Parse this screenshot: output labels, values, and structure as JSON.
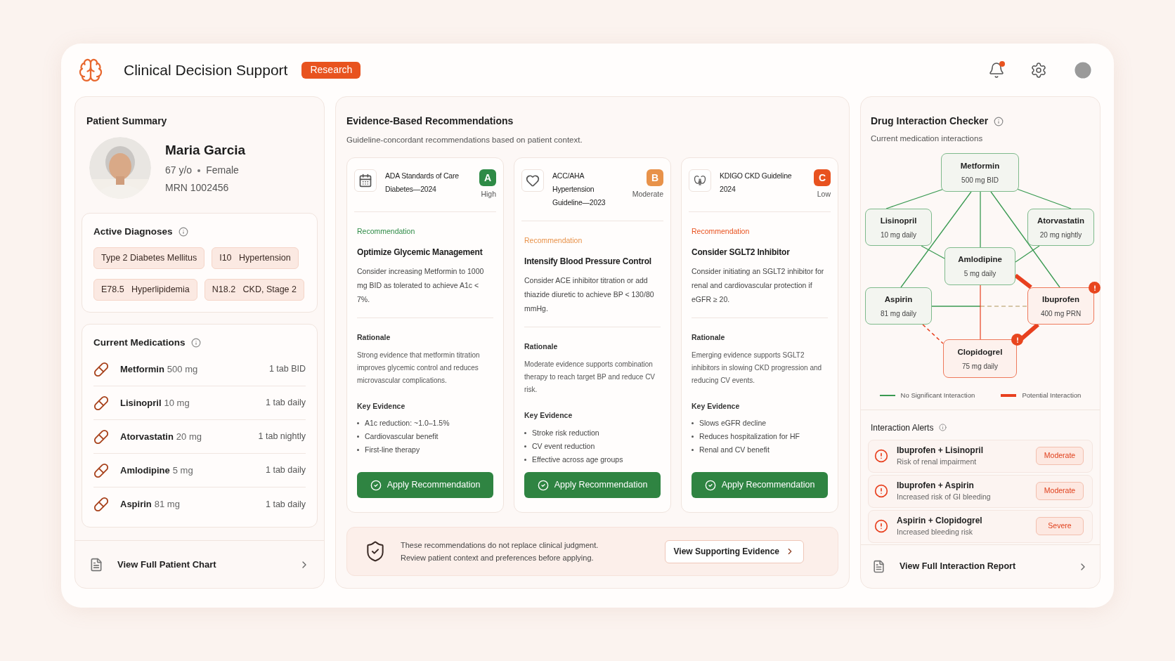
{
  "header": {
    "title": "Clinical Decision Support",
    "badge": "Research",
    "notifications": true
  },
  "patient": {
    "title": "Patient Summary",
    "name": "Maria Garcia",
    "age": "67 y/o",
    "sex": "Female",
    "mrn": "MRN 1002456",
    "diagnoses_title": "Active Diagnoses",
    "diagnoses": [
      {
        "name": "Type 2 Diabetes Mellitus"
      },
      {
        "code": "I10",
        "name": "Hypertension"
      },
      {
        "code": "E78.5",
        "name": "Hyperlipidemia"
      },
      {
        "code": "N18.2",
        "name": "CKD, Stage 2"
      }
    ],
    "medications_title": "Current Medications",
    "medications": [
      {
        "name": "Metformin",
        "dose": "500 mg",
        "sig": "1 tab BID"
      },
      {
        "name": "Lisinopril",
        "dose": "10 mg",
        "sig": "1 tab daily"
      },
      {
        "name": "Atorvastatin",
        "dose": "20 mg",
        "sig": "1 tab nightly"
      },
      {
        "name": "Amlodipine",
        "dose": "5 mg",
        "sig": "1 tab daily"
      },
      {
        "name": "Aspirin",
        "dose": "81 mg",
        "sig": "1 tab daily"
      }
    ],
    "footer_link": "View Full Patient Chart"
  },
  "recommendations": {
    "title": "Evidence-Based Recommendations",
    "subtitle": "Guideline-concordant recommendations based on patient context.",
    "cards": [
      {
        "source": "ADA Standards of Care Diabetes—2024",
        "grade": "A",
        "strength": "High",
        "color": "#2e8b46",
        "label": "Recommendation",
        "title": "Optimize Glycemic Management",
        "text": "Consider increasing Metformin to 1000 mg BID as tolerated to achieve A1c < 7%.",
        "rationale_title": "Rationale",
        "rationale": "Strong evidence that metformin titration improves glycemic control and reduces microvascular complications.",
        "evidence_title": "Key Evidence",
        "evidence": [
          "A1c reduction: ~1.0–1.5%",
          "Cardiovascular benefit",
          "First-line therapy"
        ],
        "button": "Apply Recommendation"
      },
      {
        "source": "ACC/AHA Hypertension Guideline—2023",
        "grade": "B",
        "strength": "Moderate",
        "color": "#e8924a",
        "label": "Recommendation",
        "title": "Intensify Blood Pressure Control",
        "text": "Consider ACE inhibitor titration or add thiazide diuretic to achieve BP < 130/80 mmHg.",
        "rationale_title": "Rationale",
        "rationale": "Moderate evidence supports combination therapy to reach target BP and reduce CV risk.",
        "evidence_title": "Key Evidence",
        "evidence": [
          "Stroke risk reduction",
          "CV event reduction",
          "Effective across age groups"
        ],
        "button": "Apply Recommendation"
      },
      {
        "source": "KDIGO CKD Guideline 2024",
        "grade": "C",
        "strength": "Low",
        "color": "#e8521f",
        "label": "Recommendation",
        "title": "Consider SGLT2 Inhibitor",
        "text": "Consider initiating an SGLT2 inhibitor for renal and cardiovascular protection if eGFR ≥ 20.",
        "rationale_title": "Rationale",
        "rationale": "Emerging evidence supports SGLT2 inhibitors in slowing CKD progression and reducing CV events.",
        "evidence_title": "Key Evidence",
        "evidence": [
          "Slows eGFR decline",
          "Reduces hospitalization for HF",
          "Renal and CV benefit"
        ],
        "button": "Apply Recommendation"
      }
    ],
    "disclaimer": [
      "These recommendations do not replace clinical judgment.",
      "Review patient context and preferences before applying."
    ],
    "evidence_button": "View Supporting Evidence"
  },
  "interactions": {
    "title": "Drug Interaction Checker",
    "subtitle": "Current medication interactions",
    "nodes": [
      {
        "name": "Metformin",
        "dose": "500 mg BID",
        "alert": false
      },
      {
        "name": "Lisinopril",
        "dose": "10 mg daily",
        "alert": false
      },
      {
        "name": "Atorvastatin",
        "dose": "20 mg nightly",
        "alert": false
      },
      {
        "name": "Amlodipine",
        "dose": "5 mg daily",
        "alert": false
      },
      {
        "name": "Aspirin",
        "dose": "81 mg daily",
        "alert": false
      },
      {
        "name": "Ibuprofen",
        "dose": "400 mg PRN",
        "alert": true
      },
      {
        "name": "Clopidogrel",
        "dose": "75 mg daily",
        "alert": true
      }
    ],
    "legend": [
      {
        "label": "No Significant Interaction",
        "color": "#3a9a52"
      },
      {
        "label": "Potential Interaction",
        "color": "#e8401f"
      }
    ],
    "alerts_title": "Interaction Alerts",
    "alerts": [
      {
        "pair": "Ibuprofen + Lisinopril",
        "detail": "Risk of renal impairment",
        "severity": "Moderate"
      },
      {
        "pair": "Ibuprofen + Aspirin",
        "detail": "Increased risk of GI bleeding",
        "severity": "Moderate"
      },
      {
        "pair": "Aspirin + Clopidogrel",
        "detail": "Increased bleeding risk",
        "severity": "Severe"
      }
    ],
    "footer_link": "View Full Interaction Report"
  }
}
